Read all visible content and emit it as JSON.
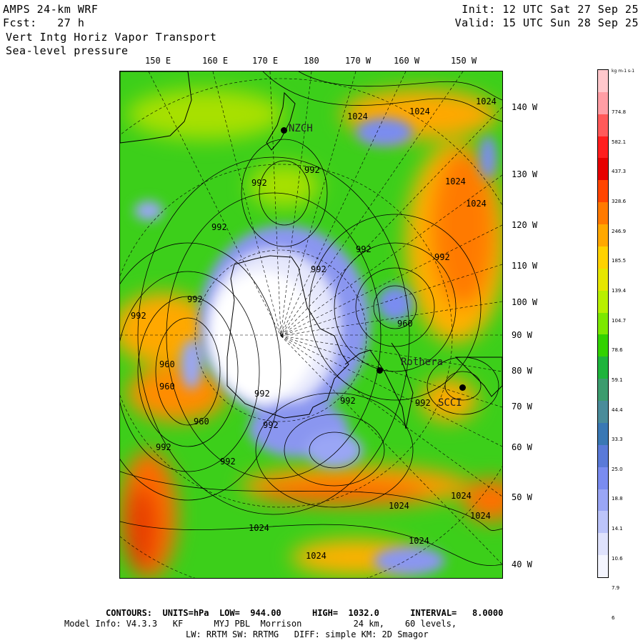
{
  "header": {
    "model": "AMPS 24-km WRF",
    "forecast": "Fcst:   27 h",
    "field1": "Vert Intg Horiz Vapor Transport",
    "field2": "Sea-level pressure",
    "init": "Init: 12 UTC Sat 27 Sep 25",
    "valid": "Valid: 15 UTC Sun 28 Sep 25"
  },
  "top_longitudes": [
    "150 E",
    "160 E",
    "170 E",
    "180",
    "170 W",
    "160 W",
    "150 W"
  ],
  "right_longitudes": [
    "140 W",
    "130 W",
    "120 W",
    "110 W",
    "100 W",
    "90 W",
    "80 W",
    "70 W",
    "60 W",
    "50 W",
    "40 W"
  ],
  "stations": [
    "NZCH",
    "Rothera",
    "SCCI"
  ],
  "isobar_labels": [
    "1024",
    "1024",
    "1024",
    "992",
    "992",
    "992",
    "992",
    "992",
    "992",
    "992",
    "992",
    "992",
    "992",
    "992",
    "960",
    "960",
    "960",
    "960",
    "992",
    "992",
    "1024",
    "1024",
    "1024",
    "1024",
    "1024",
    "1024",
    "1024",
    "1024",
    "992"
  ],
  "colorbar": {
    "units": "kg m-1 s-1",
    "labels": [
      "774.8",
      "582.1",
      "437.3",
      "328.6",
      "246.9",
      "185.5",
      "139.4",
      "104.7",
      "78.6",
      "59.1",
      "44.4",
      "33.3",
      "25.0",
      "18.8",
      "14.1",
      "10.6",
      "7.9",
      "6"
    ],
    "colors": [
      "#ffc8cc",
      "#ff9ea5",
      "#ff5a5a",
      "#ff1e1e",
      "#e60000",
      "#ff4500",
      "#ff7a00",
      "#ffa800",
      "#ffd200",
      "#e6e600",
      "#b8f000",
      "#7ce800",
      "#32d200",
      "#1eb43c",
      "#3c9c6e",
      "#4a8c9a",
      "#3a78b4",
      "#5a7ad8",
      "#7a8cf0",
      "#9aa6f5",
      "#bcc4fa",
      "#dfe2fc",
      "#f4f5fe"
    ]
  },
  "footer": {
    "line1": "CONTOURS:  UNITS=hPa  LOW=  944.00      HIGH=  1032.0      INTERVAL=   8.0000",
    "line2": "Model Info: V4.3.3   KF      MYJ PBL  Morrison          24 km,    60 levels,",
    "line3": "LW: RRTM SW: RRTMG   DIFF: simple KM: 2D Smagor"
  }
}
